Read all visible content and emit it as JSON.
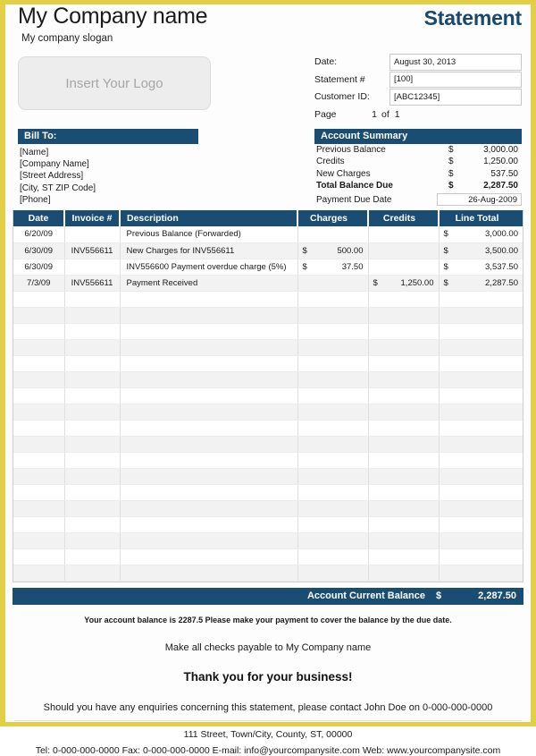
{
  "brand": {
    "accent_navy": "#1a4d73",
    "border_gold": "#e3cf45",
    "title_blue": "#17486f"
  },
  "header": {
    "company_name": "My Company name",
    "company_slogan": "My company slogan",
    "document_title": "Statement",
    "logo_placeholder": "Insert Your Logo"
  },
  "meta": {
    "date_label": "Date:",
    "date_value": "August 30, 2013",
    "statement_label": "Statement #",
    "statement_value": "[100]",
    "customer_label": "Customer ID:",
    "customer_value": "[ABC12345]",
    "page_label": "Page",
    "page_current": "1",
    "page_of": "of",
    "page_total": "1"
  },
  "bill_to": {
    "heading": "Bill To:",
    "lines": [
      "[Name]",
      "[Company Name]",
      "[Street Address]",
      "[City, ST  ZIP Code]",
      "[Phone]"
    ]
  },
  "account_summary": {
    "heading": "Account Summary",
    "rows": [
      {
        "label": "Previous Balance",
        "currency": "$",
        "amount": "3,000.00"
      },
      {
        "label": "Credits",
        "currency": "$",
        "amount": "1,250.00"
      },
      {
        "label": "New Charges",
        "currency": "$",
        "amount": "537.50"
      },
      {
        "label": "Total Balance Due",
        "currency": "$",
        "amount": "2,287.50"
      }
    ],
    "due_date_label": "Payment Due Date",
    "due_date_value": "26-Aug-2009"
  },
  "table": {
    "columns": [
      "Date",
      "Invoice #",
      "Description",
      "Charges",
      "Credits",
      "Line Total"
    ],
    "rows": [
      {
        "date": "6/20/09",
        "invoice": "",
        "description": "Previous Balance (Forwarded)",
        "charges_cur": "",
        "charges": "",
        "credits_cur": "",
        "credits": "",
        "line_cur": "$",
        "line_total": "3,000.00"
      },
      {
        "date": "6/30/09",
        "invoice": "INV556611",
        "description": "New Charges for INV556611",
        "charges_cur": "$",
        "charges": "500.00",
        "credits_cur": "",
        "credits": "",
        "line_cur": "$",
        "line_total": "3,500.00"
      },
      {
        "date": "6/30/09",
        "invoice": "",
        "description": "INV556600 Payment overdue charge (5%)",
        "charges_cur": "$",
        "charges": "37.50",
        "credits_cur": "",
        "credits": "",
        "line_cur": "$",
        "line_total": "3,537.50"
      },
      {
        "date": "7/3/09",
        "invoice": "INV556611",
        "description": "Payment Received",
        "charges_cur": "",
        "charges": "",
        "credits_cur": "$",
        "credits": "1,250.00",
        "line_cur": "$",
        "line_total": "2,287.50"
      }
    ],
    "empty_row_count": 18
  },
  "balance_bar": {
    "label": "Account Current Balance",
    "currency": "$",
    "amount": "2,287.50"
  },
  "footer": {
    "note": "Your account balance is 2287.5 Please make your payment to cover the balance by the due date.",
    "checks": "Make all checks payable to My Company name",
    "thanks": "Thank you for your business!",
    "enquiries": "Should you have any enquiries concerning this statement, please contact John Doe on 0-000-000-0000",
    "address": "111 Street, Town/City, County, ST, 00000",
    "contact": "Tel: 0-000-000-0000 Fax: 0-000-000-0000 E-mail: info@yourcompanysite.com Web: www.yourcompanysite.com"
  }
}
